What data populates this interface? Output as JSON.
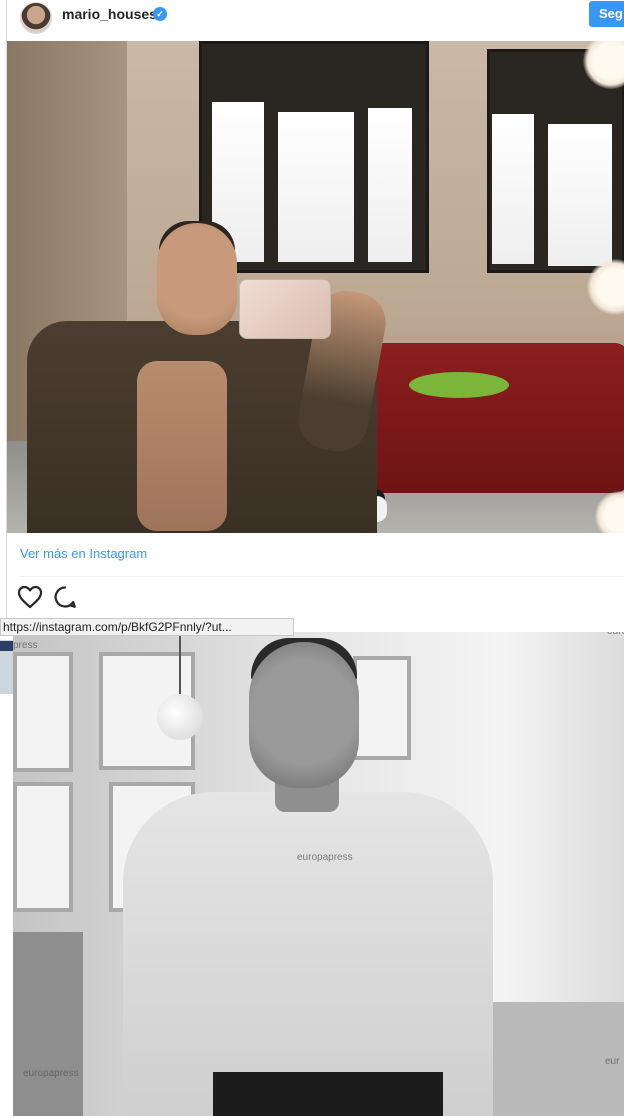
{
  "embed": {
    "username": "mario_houses",
    "verified_icon": "verified-badge-icon",
    "follow_label": "Seg",
    "more_link": "Ver más en Instagram",
    "actions": [
      {
        "icon": "heart-icon"
      },
      {
        "icon": "comment-icon"
      }
    ]
  },
  "tooltip": {
    "url": "https://instagram.com/p/BkfG2PFnnly/?ut..."
  },
  "photo2": {
    "watermark_top": "press",
    "watermark_center": "europapress",
    "watermark_bottom": "europapress",
    "watermark_right": "euro",
    "watermark_right_bottom": "eur"
  },
  "colors": {
    "accent": "#3897f0",
    "text": "#262626"
  }
}
